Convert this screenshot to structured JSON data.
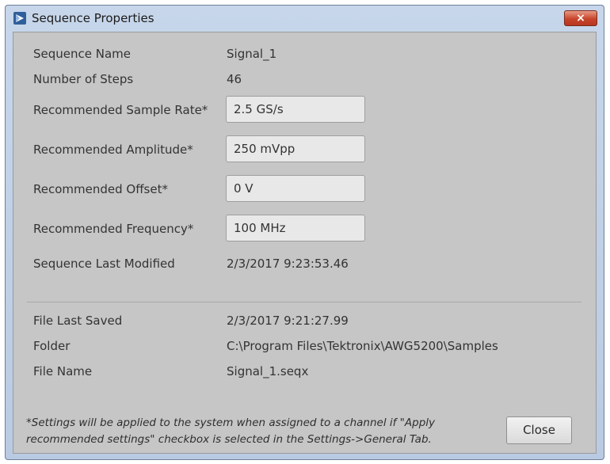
{
  "window": {
    "title": "Sequence Properties",
    "close_glyph": "×"
  },
  "properties": {
    "sequence_name_label": "Sequence Name",
    "sequence_name_value": "Signal_1",
    "number_of_steps_label": "Number of Steps",
    "number_of_steps_value": "46",
    "sample_rate_label": "Recommended Sample Rate*",
    "sample_rate_value": "2.5 GS/s",
    "amplitude_label": "Recommended Amplitude*",
    "amplitude_value": "250 mVpp",
    "offset_label": "Recommended Offset*",
    "offset_value": "0 V",
    "frequency_label": "Recommended Frequency*",
    "frequency_value": "100 MHz",
    "last_modified_label": "Sequence Last Modified",
    "last_modified_value": "2/3/2017 9:23:53.46"
  },
  "file_info": {
    "last_saved_label": "File Last Saved",
    "last_saved_value": "2/3/2017 9:21:27.99",
    "folder_label": "Folder",
    "folder_value": "C:\\Program Files\\Tektronix\\AWG5200\\Samples",
    "file_name_label": "File Name",
    "file_name_value": "Signal_1.seqx"
  },
  "footer": {
    "note_line1": "*Settings will be applied to the system when assigned to a channel if \"Apply",
    "note_line2": "recommended settings\" checkbox is selected in the Settings->General Tab.",
    "close_label": "Close"
  },
  "colors": {
    "titlebar": "#c7d6ea",
    "panel": "#c6c6c6",
    "close_x": "#c8452c"
  },
  "icons": {
    "app": "tektronix-app-icon",
    "close": "close-x-icon"
  }
}
